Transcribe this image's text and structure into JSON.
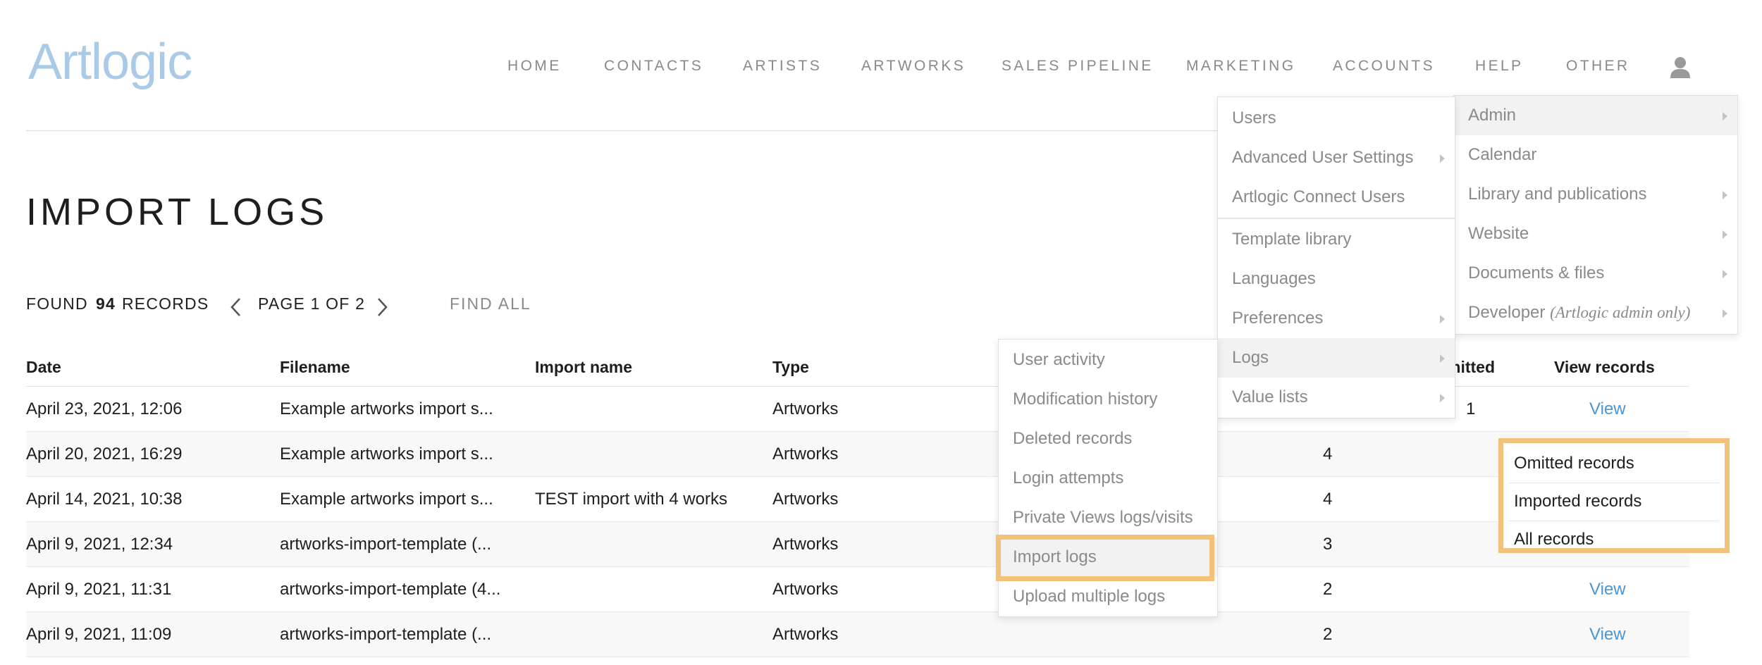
{
  "logo": "Artlogic",
  "nav": {
    "items": [
      "HOME",
      "CONTACTS",
      "ARTISTS",
      "ARTWORKS",
      "SALES PIPELINE",
      "MARKETING",
      "ACCOUNTS",
      "HELP",
      "OTHER"
    ],
    "user_icon": "user-icon"
  },
  "page": {
    "title": "IMPORT LOGS",
    "found_prefix": "FOUND",
    "found_count": "94",
    "found_suffix": "RECORDS",
    "page_label": "PAGE 1 OF 2",
    "find_all": "FIND ALL"
  },
  "table": {
    "headers": [
      "Date",
      "Filename",
      "Import name",
      "Type",
      "mitted",
      "View records"
    ],
    "rows": [
      {
        "date": "April 23, 2021, 12:06",
        "filename": "Example artworks import s...",
        "import_name": "",
        "type": "Artworks",
        "count": "1",
        "view": "View"
      },
      {
        "date": "April 20, 2021, 16:29",
        "filename": "Example artworks import s...",
        "import_name": "",
        "type": "Artworks",
        "count": "4",
        "view": ""
      },
      {
        "date": "April 14, 2021, 10:38",
        "filename": "Example artworks import s...",
        "import_name": "TEST import with 4 works",
        "type": "Artworks",
        "count": "4",
        "view": ""
      },
      {
        "date": "April 9, 2021, 12:34",
        "filename": "artworks-import-template (...",
        "import_name": "",
        "type": "Artworks",
        "count": "3",
        "view": ""
      },
      {
        "date": "April 9, 2021, 11:31",
        "filename": "artworks-import-template (4...",
        "import_name": "",
        "type": "Artworks",
        "count": "2",
        "view": "View"
      },
      {
        "date": "April 9, 2021, 11:09",
        "filename": "artworks-import-template (...",
        "import_name": "",
        "type": "Artworks",
        "count": "2",
        "view": "View"
      }
    ]
  },
  "other_menu": {
    "items": [
      {
        "label": "Admin",
        "submenu": true,
        "active": true
      },
      {
        "label": "Calendar",
        "submenu": false
      },
      {
        "label": "Library and publications",
        "submenu": true
      },
      {
        "label": "Website",
        "submenu": true
      },
      {
        "label": "Documents & files",
        "submenu": true
      },
      {
        "label": "Developer",
        "note": "(Artlogic admin only)",
        "submenu": true
      }
    ]
  },
  "admin_menu": {
    "items": [
      {
        "label": "Users",
        "submenu": false
      },
      {
        "label": "Advanced User Settings",
        "submenu": true
      },
      {
        "label": "Artlogic Connect Users",
        "submenu": false
      },
      {
        "label": "Template library",
        "submenu": false
      },
      {
        "label": "Languages",
        "submenu": false
      },
      {
        "label": "Preferences",
        "submenu": true
      },
      {
        "label": "Logs",
        "submenu": true,
        "active": true
      },
      {
        "label": "Value lists",
        "submenu": true
      }
    ]
  },
  "logs_menu": {
    "items": [
      {
        "label": "User activity"
      },
      {
        "label": "Modification history"
      },
      {
        "label": "Deleted records"
      },
      {
        "label": "Login attempts"
      },
      {
        "label": "Private Views logs/visits"
      },
      {
        "label": "Import logs",
        "active": true
      },
      {
        "label": "Upload multiple logs"
      }
    ]
  },
  "records_popup": {
    "items": [
      "Omitted records",
      "Imported records",
      "All records"
    ]
  },
  "colors": {
    "highlight": "#f2c27a",
    "link": "#4a94d6",
    "logo": "#a9cbe8"
  }
}
